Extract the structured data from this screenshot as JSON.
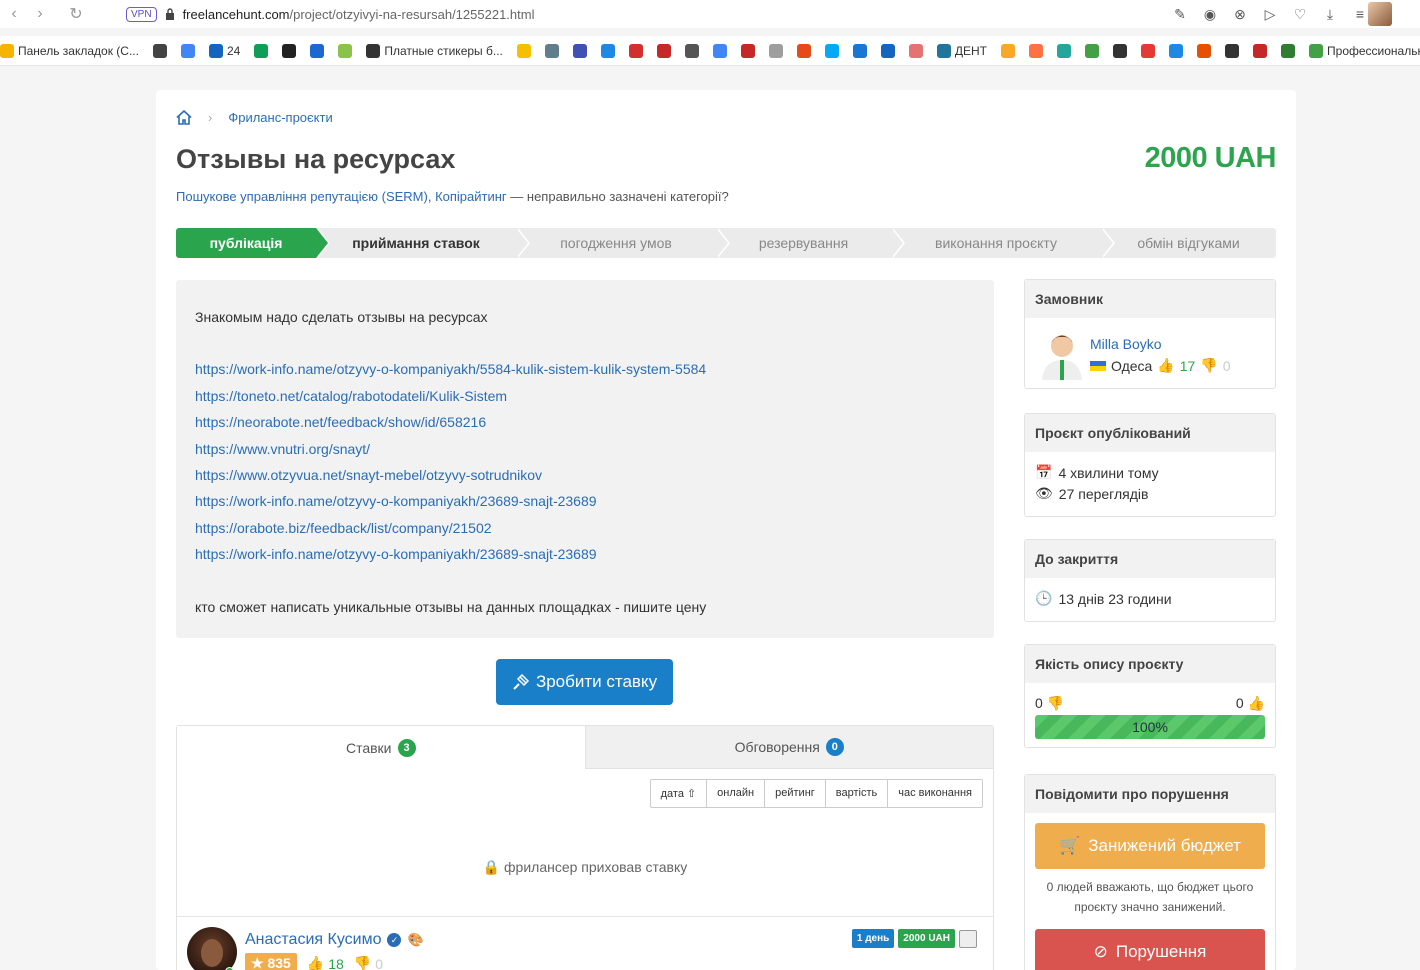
{
  "browser": {
    "vpn": "VPN",
    "url_host": "freelancehunt.com",
    "url_path": "/project/otzyivyi-na-resursah/1255221.html"
  },
  "bookmarks": [
    {
      "label": "Панель закладок (С...",
      "color": "#f5b400"
    },
    {
      "label": "",
      "color": "#444"
    },
    {
      "label": "",
      "color": "#4285f4"
    },
    {
      "label": "24",
      "color": "#1565c0"
    },
    {
      "label": "",
      "color": "#0f9d58"
    },
    {
      "label": "",
      "color": "#222"
    },
    {
      "label": "",
      "color": "#1e66d0"
    },
    {
      "label": "",
      "color": "#8bc34a"
    },
    {
      "label": "Платные стикеры б...",
      "color": "#333"
    },
    {
      "label": "",
      "color": "#f4c000"
    },
    {
      "label": "",
      "color": "#607d8b"
    },
    {
      "label": "",
      "color": "#3f51b5"
    },
    {
      "label": "",
      "color": "#1e88e5"
    },
    {
      "label": "",
      "color": "#d32f2f"
    },
    {
      "label": "",
      "color": "#c62828"
    },
    {
      "label": "",
      "color": "#555"
    },
    {
      "label": "",
      "color": "#4285f4"
    },
    {
      "label": "",
      "color": "#c62828"
    },
    {
      "label": "",
      "color": "#9e9e9e"
    },
    {
      "label": "",
      "color": "#e64a19"
    },
    {
      "label": "",
      "color": "#03a9f4"
    },
    {
      "label": "",
      "color": "#1976d2"
    },
    {
      "label": "",
      "color": "#1565c0"
    },
    {
      "label": "",
      "color": "#e57373"
    },
    {
      "label": "ДЕНТ",
      "color": "#21759b"
    },
    {
      "label": "",
      "color": "#f9a825"
    },
    {
      "label": "",
      "color": "#ff7043"
    },
    {
      "label": "",
      "color": "#26a69a"
    },
    {
      "label": "",
      "color": "#43a047"
    },
    {
      "label": "",
      "color": "#333"
    },
    {
      "label": "",
      "color": "#e53935"
    },
    {
      "label": "",
      "color": "#1e88e5"
    },
    {
      "label": "",
      "color": "#e65100"
    },
    {
      "label": "",
      "color": "#333"
    },
    {
      "label": "",
      "color": "#c62828"
    },
    {
      "label": "",
      "color": "#2e7d32"
    },
    {
      "label": "Профессионально...",
      "color": "#43a047"
    }
  ],
  "breadcrumb": {
    "home_icon": "home-icon",
    "link": "Фриланс-проєкти"
  },
  "project": {
    "title": "Отзывы на ресурсах",
    "price": "2000 UAH",
    "category1": "Пошукове управління репутацією (SERM)",
    "category2": "Копірайтинг",
    "wrong_cat": " — неправильно зазначені категорії?"
  },
  "steps": [
    {
      "label": "публікація",
      "state": "active"
    },
    {
      "label": "приймання ставок",
      "state": "current"
    },
    {
      "label": "погодження умов",
      "state": ""
    },
    {
      "label": "резервування",
      "state": ""
    },
    {
      "label": "виконання проєкту",
      "state": ""
    },
    {
      "label": "обмін відгуками",
      "state": ""
    }
  ],
  "description": {
    "intro": "Знакомым надо сделать отзывы на ресурсах",
    "links": [
      "https://work-info.name/otzyvy-o-kompaniyakh/5584-kulik-sistem-kulik-system-5584",
      "https://toneto.net/catalog/rabotodateli/Kulik-Sistem",
      "https://neorabote.net/feedback/show/id/658216",
      "https://www.vnutri.org/snayt/",
      "https://www.otzyvua.net/snayt-mebel/otzyvy-sotrudnikov",
      "https://work-info.name/otzyvy-o-kompaniyakh/23689-snajt-23689",
      "https://orabote.biz/feedback/list/company/21502",
      "https://work-info.name/otzyvy-o-kompaniyakh/23689-snajt-23689"
    ],
    "outro": "кто сможет написать уникальные отзывы на данных площадках - пишите цену"
  },
  "bid_button": "Зробити ставку",
  "tabs": {
    "bids_label": "Ставки",
    "bids_count": "3",
    "discussion_label": "Обговорення",
    "discussion_count": "0"
  },
  "sort": [
    "дата",
    "онлайн",
    "рейтинг",
    "вартість",
    "час виконання"
  ],
  "hidden_bid": "фрилансер приховав ставку",
  "bidder": {
    "name": "Анастасия Кусимо",
    "rating": "835",
    "likes": "18",
    "dislikes": "0",
    "term": "1 день",
    "amount": "2000 UAH"
  },
  "sidebar": {
    "customer_head": "Замовник",
    "customer_name": "Milla Boyko",
    "customer_city": "Одеса",
    "customer_likes": "17",
    "customer_dislikes": "0",
    "published_head": "Проєкт опублікований",
    "published_ago": "4 хвилини тому",
    "views": "27 переглядів",
    "close_head": "До закриття",
    "close_time": "13 днів 23 години",
    "quality_head": "Якість опису проєкту",
    "quality_down": "0",
    "quality_up": "0",
    "quality_percent": "100%",
    "quality_value": 1.0,
    "report_head": "Повідомити про порушення",
    "low_budget": "Занижений бюджет",
    "low_budget_note": "0 людей вважають, що бюджет цього проєкту значно занижений.",
    "violation": "Порушення"
  },
  "colors": {
    "green": "#2aa54d",
    "blue": "#1a7fc9",
    "orange": "#f0ad4e",
    "red": "#d9534f"
  }
}
